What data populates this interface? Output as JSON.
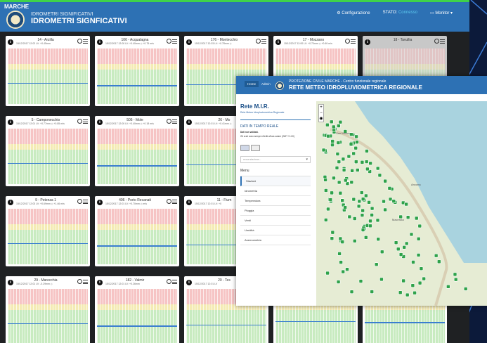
{
  "dashboard": {
    "region_label": "MARCHE",
    "subtitle": "IDROMETRI SIGNIFICATIVI",
    "title": "IDROMETRI SIGNFICATIVI",
    "nav": {
      "config": "Configurazione",
      "stato_label": "STATO:",
      "stato_value": "Connesso",
      "monitor": "Monitor ▾"
    },
    "cards": [
      {
        "title": "14 - Arzilla",
        "meta": "15/12/2017 12:02 LV: +0.45mm"
      },
      {
        "title": "106 - Acqualagna",
        "meta": "15/12/2017 12:00 LV: +0.40mm ◇ +0.75 m/s"
      },
      {
        "title": "176 - Montecchio",
        "meta": "15/12/2017 12:03 LV: +0.78mm ◇"
      },
      {
        "title": "17 - Mozzano",
        "meta": "15/12/2017 12:00 LV: +0.70mm ◇ +0.69 m/s"
      },
      {
        "title": "18 - Tavullia",
        "meta": ""
      },
      {
        "title": "5 - Camponecchio",
        "meta": "15/12/2017 12:01 LV: +0.77mm ◇ +0.85 m/s"
      },
      {
        "title": "506 - Mole",
        "meta": "15/12/2017 12:00 LV: +0.40mm ◇ +0.18 m/s"
      },
      {
        "title": "26 - Mo",
        "meta": "15/12/2017 12:01 LV: +0.41mm ◇"
      },
      {
        "title": "",
        "meta": ""
      },
      {
        "title": "",
        "meta": ""
      },
      {
        "title": "9 - Potenza 1",
        "meta": "15/12/2017 12:03 LV: +0.69mm ◇ +1.46 m/s"
      },
      {
        "title": "406 - Porto Recanati",
        "meta": "15/12/2017 12:01 LV: +0.70mm ◇ m/s"
      },
      {
        "title": "11 - Fium",
        "meta": "15/12/2017 12:01 LV: +0"
      },
      {
        "title": "",
        "meta": ""
      },
      {
        "title": "",
        "meta": ""
      },
      {
        "title": "29 - Marecchia",
        "meta": "15/12/2017 12:01 LV: -0.29mm ◇"
      },
      {
        "title": "182 - Valmir",
        "meta": "15/12/2017 12:01 LV: +0.26mm"
      },
      {
        "title": "20 - Tes",
        "meta": "15/12/2017 12:01 LV"
      },
      {
        "title": "",
        "meta": ""
      },
      {
        "title": "",
        "meta": ""
      }
    ]
  },
  "mir": {
    "tabs": [
      "Home",
      "Admin"
    ],
    "subtitle": "PROTEZIONE CIVILE MARCHE - Centro funzionale regionale",
    "title": "RETE METEO IDROPLUVIOMETRICA REGIONALE",
    "side_title": "Rete M.I.R.",
    "side_sub": "Rete Meteo Idropluviometrica Regionale",
    "realtime": "DATI IN TEMPO REALE",
    "note1": "Dati non validati.",
    "note2": "Gli orari sono sempre riferiti all'ora solare (GMT +1:00)",
    "select_placeholder": "cerca stazione...",
    "menu_header": "Menu",
    "menu_items": [
      "Stazioni",
      "Idrometria",
      "Temperatura",
      "Pioggia",
      "Venti",
      "Umidità",
      "Anemometria"
    ],
    "map_labels": [
      "San Marino",
      "Ancona",
      "Macerata"
    ]
  }
}
